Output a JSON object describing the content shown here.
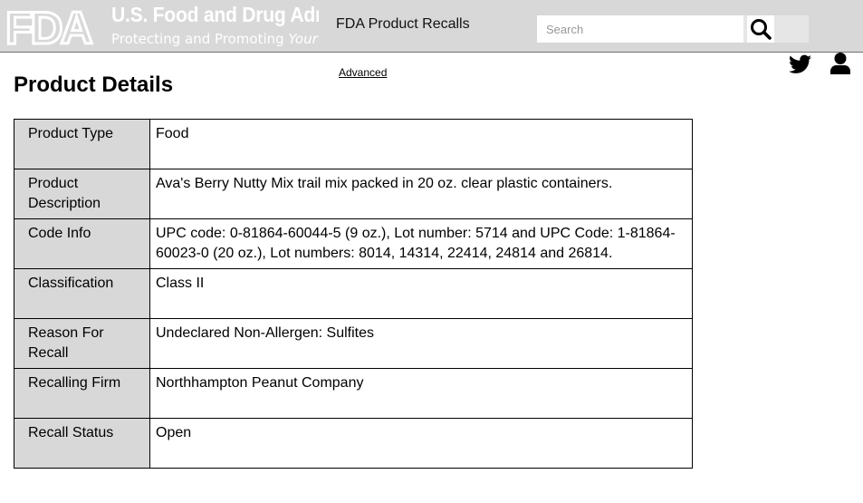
{
  "header": {
    "logo": {
      "mark": "FDA",
      "title": "U.S. Food and Drug Administration",
      "tagline_prefix": "Protecting and Promoting ",
      "tagline_emphasis": "Your Health"
    },
    "app_title": "FDA Product Recalls",
    "search": {
      "placeholder": "Search",
      "icon": "search-icon"
    },
    "icons": {
      "twitter": "twitter-icon",
      "user": "user-icon"
    }
  },
  "advanced_link": "Advanced",
  "page_title": "Product Details",
  "details": [
    {
      "label": "Product Type",
      "value": "Food"
    },
    {
      "label": "Product Description",
      "value": "Ava's Berry Nutty Mix trail mix packed in 20 oz. clear plastic containers."
    },
    {
      "label": "Code Info",
      "value": "UPC code: 0-81864-60044-5 (9 oz.), Lot number: 5714 and UPC Code: 1-81864-60023-0 (20 oz.), Lot numbers: 8014, 14314, 22414, 24814 and 26814."
    },
    {
      "label": "Classification",
      "value": "Class II"
    },
    {
      "label": "Reason For Recall",
      "value": "Undeclared Non-Allergen: Sulfites"
    },
    {
      "label": "Recalling Firm",
      "value": "Northhampton Peanut Company"
    },
    {
      "label": "Recall Status",
      "value": "Open"
    }
  ],
  "colors": {
    "header_bg": "#d8d8d8",
    "label_cell_bg": "#d8d8d8",
    "logo_text": "#ffffff"
  }
}
